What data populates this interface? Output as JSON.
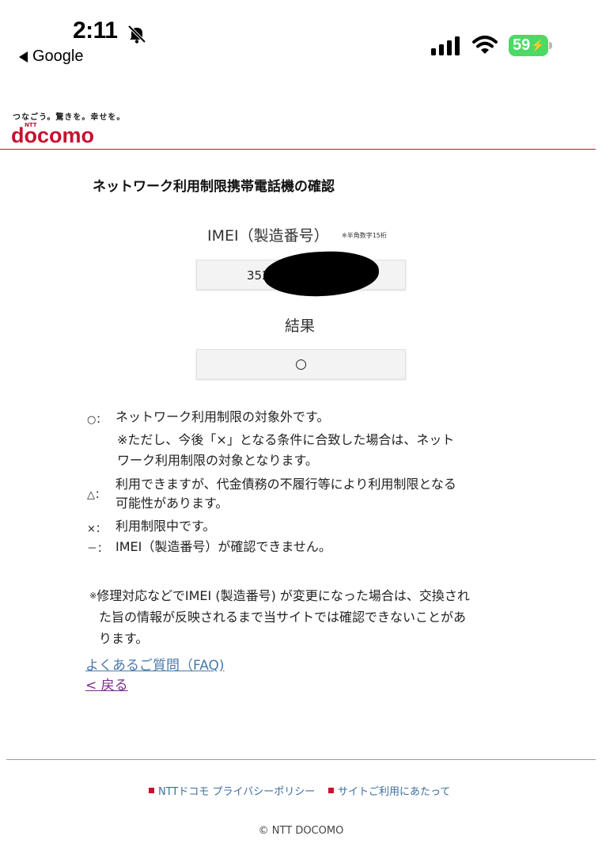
{
  "status_bar": {
    "time": "2:11",
    "back_app": "Google",
    "battery": "59"
  },
  "header": {
    "tagline": "つなごう。驚きを。幸せを。",
    "ntt": "NTT",
    "logo": "docomo"
  },
  "main": {
    "title": "ネットワーク利用制限携帯電話機の確認",
    "imei_label": "IMEI（製造番号）",
    "imei_note": "※半角数字15桁",
    "imei_value": "352",
    "result_label": "結果",
    "result_value": "○"
  },
  "legend": {
    "circle_mark": "○：",
    "circle_text1": "ネットワーク利用制限の対象外です。",
    "circle_text2": "※ただし、今後「×」となる条件に合致した場合は、ネット",
    "circle_text3": "ワーク利用制限の対象となります。",
    "triangle_mark": "△：",
    "triangle_text1": "利用できますが、代金債務の不履行等により利用制限となる",
    "triangle_text2": "可能性があります。",
    "cross_mark": "×：",
    "cross_text": "利用制限中です。",
    "dash_mark": "－：",
    "dash_text": "IMEI（製造番号）が確認できません。"
  },
  "note": {
    "mark": "※",
    "line1": "修理対応などでIMEI (製造番号) が変更になった場合は、交換され",
    "line2": "た旨の情報が反映されるまで当サイトでは確認できないことがあ",
    "line3": "ります。"
  },
  "links": {
    "faq": "よくあるご質問（FAQ)",
    "back": "< 戻る"
  },
  "footer": {
    "privacy": "NTTドコモ プライバシーポリシー",
    "terms": "サイトご利用にあたって",
    "copyright": "© NTT DOCOMO"
  },
  "colors": {
    "brand": "#c8102e",
    "link": "#4a7aa8",
    "visited": "#7a2a8c",
    "battery": "#4cd964"
  },
  "icons": [
    "bell-slash-icon",
    "signal-icon",
    "wifi-icon",
    "battery-charging-icon",
    "external-link-icon"
  ]
}
